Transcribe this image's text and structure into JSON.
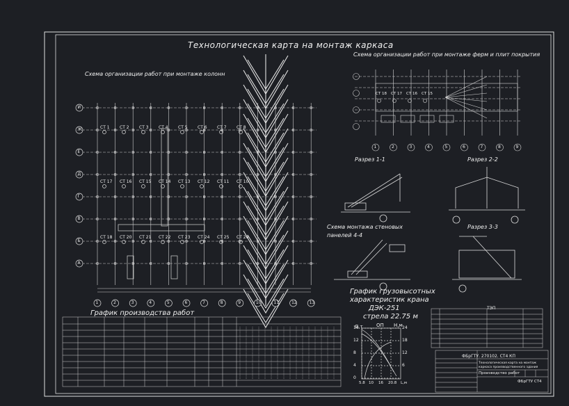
{
  "sheet": {
    "main_title": "Технологическая карта на монтаж каркаса",
    "columns_section_title": "Схема организации работ при монтаже колонн",
    "trusses_section_title": "Схема организации работ при монтаже ферм и плит покрытия",
    "section_1": "Разрез 1-1",
    "section_2": "Разрез 2-2",
    "section_3": "Разрез 3-3",
    "wall_panels_title_1": "Схема монтажа стеновых",
    "wall_panels_title_2": "панелей 4-4",
    "schedule_title": "График производства работ",
    "crane_chart_title_1": "График грузовысотных",
    "crane_chart_title_2": "характеристик крана",
    "crane_model": "ДЭК-251",
    "boom": "стрела 22.75 м",
    "chart_y_left": "G,т",
    "chart_y_mid": "ОП",
    "chart_y_right": "H,м",
    "tep_title": "ТЭП",
    "stamp_code": "ФБрГТУ. 270102. СТ4 КП",
    "stamp_desc_1": "Технологическая карта на монтаж",
    "stamp_desc_2": "каркаса производственного здания",
    "stamp_org": "ФБрГТУ СТ4",
    "stamp_sheet_name": "Производство работ"
  },
  "column_stations_row1": [
    "СТ 1",
    "СТ 2",
    "СТ 3",
    "СТ 4",
    "СТ 5",
    "СТ 6",
    "СТ 7",
    "СТ 8"
  ],
  "column_stations_row2": [
    "СТ 17",
    "СТ 16",
    "СТ 15",
    "СТ 14",
    "СТ 13",
    "СТ 12",
    "СТ 11",
    "СТ 10"
  ],
  "column_stations_row3": [
    "СТ 18",
    "СТ 20",
    "СТ 21",
    "СТ 22",
    "СТ 23",
    "СТ 24",
    "СТ 25",
    "СТ 26"
  ],
  "truss_stations": [
    "СТ 18",
    "СТ 17",
    "СТ 16",
    "СТ 15"
  ],
  "axis_numbers": [
    "1",
    "2",
    "3",
    "4",
    "5",
    "6",
    "7",
    "8",
    "9",
    "10",
    "11",
    "12",
    "13"
  ],
  "axis_letters": [
    "И",
    "Ж",
    "Е",
    "Д",
    "Г",
    "В",
    "Б",
    "А"
  ],
  "crane_chart": {
    "type": "line",
    "y_left_ticks": [
      "16",
      "12",
      "8",
      "4",
      "0"
    ],
    "y_right_ticks": [
      "24",
      "18",
      "12",
      "6"
    ],
    "x_ticks": [
      "5.8",
      "10",
      "16",
      "20.8"
    ],
    "x_unit": "L,м"
  }
}
